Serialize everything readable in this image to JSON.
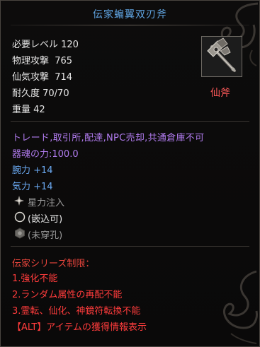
{
  "tooltip": {
    "title": "伝家蝙翼双刃斧",
    "stats": [
      "必要レベル 120",
      "物理攻撃  765",
      "仙気攻撃  714",
      "耐久度 70/70",
      "重量 42"
    ],
    "weapon_type": "仙斧",
    "restrictions": "トレード,取引所,配達,NPC売却,共通倉庫不可",
    "soul_power": "器魂の力:100.0",
    "bonuses": [
      "腕力 +14",
      "気力 +14"
    ],
    "sockets": [
      {
        "label": "星力注入",
        "icon": "star-icon"
      },
      {
        "label": "(嵌込可)",
        "icon": "circle-icon"
      },
      {
        "label": "(未穿孔)",
        "icon": "hexagon-icon"
      }
    ],
    "series_header": "伝家シリーズ制限：",
    "series_rules": [
      "1.強化不能",
      "2.ランダム属性の再配不能",
      "3.霊転、仙化、神鏡符転換不能"
    ],
    "alt_hint": "【ALT】アイテムの獲得情報表示"
  },
  "colors": {
    "title": "#5fa3e0",
    "weapon_type": "#ff5a5a",
    "restriction": "#b27cf0",
    "bonus": "#6aa8f0",
    "rule": "#ff3c3c"
  }
}
